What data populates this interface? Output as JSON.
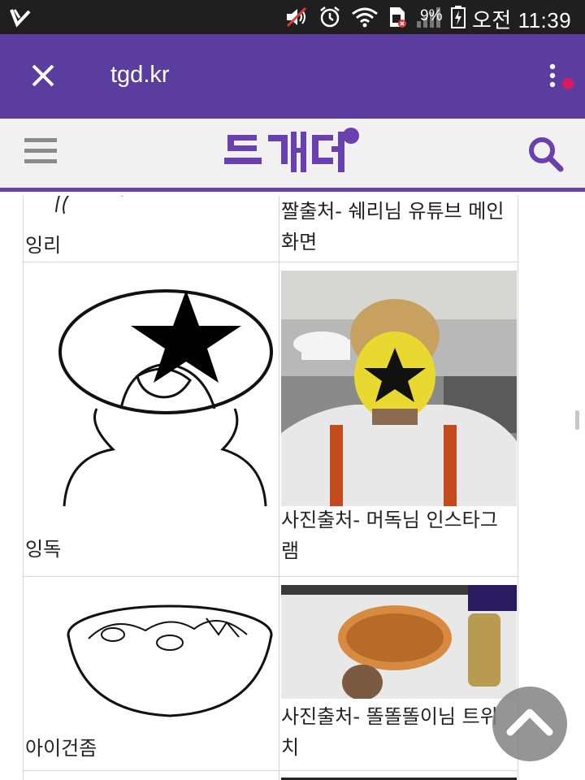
{
  "status_bar": {
    "battery_percent": "9%",
    "clock": "오전 11:39",
    "icons": [
      "app-notification-icon",
      "mute-icon",
      "alarm-icon",
      "wifi-icon",
      "sim-icon",
      "signal-icon",
      "battery-charging-icon"
    ]
  },
  "browser_bar": {
    "url": "tgd.kr",
    "close_icon": "close-icon",
    "menu_icon": "overflow-menu-icon",
    "accent": "#5b3da0"
  },
  "site_header": {
    "logo_text": "트게더",
    "menu_icon": "hamburger-icon",
    "search_icon": "search-icon",
    "brand_color": "#6a3fb0"
  },
  "grid_rows": [
    {
      "left_caption": "잉리",
      "right_caption": "짤출처- 쉐리님 유튜브 메인화면"
    },
    {
      "left_caption": "잉독",
      "right_caption": "사진출처- 머독님 인스타그램"
    },
    {
      "left_caption": "아이건좀",
      "right_caption": "사진출처- 똘똘똘이님 트위치"
    }
  ],
  "scroll_top_icon": "chevron-up-icon"
}
